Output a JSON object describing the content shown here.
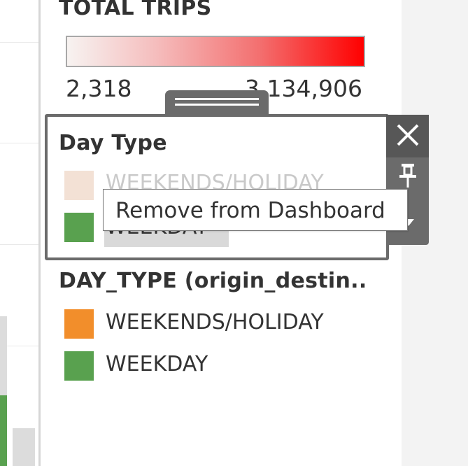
{
  "color_legend": {
    "title": "TOTAL TRIPS",
    "min_label": "2,318",
    "max_label": "3,134,906",
    "ramp_start_color": "#f7f3f1",
    "ramp_end_color": "#ff0000"
  },
  "day_type_legend": {
    "title": "Day Type",
    "items": [
      {
        "label": "WEEKENDS/HOLIDAY",
        "color": "#f3e1d5",
        "faded": true
      },
      {
        "label": "WEEKDAY",
        "color": "#59a14f",
        "highlighted": true
      }
    ],
    "toolbar": {
      "close_icon": "close-icon",
      "pin_icon": "pin-icon",
      "more_icon": "chevron-down-icon"
    }
  },
  "tooltip": {
    "text": "Remove from Dashboard"
  },
  "od_legend": {
    "title": "DAY_TYPE (origin_destin..",
    "items": [
      {
        "label": "WEEKENDS/HOLIDAY",
        "color": "#f28e2b"
      },
      {
        "label": "WEEKDAY",
        "color": "#59a14f"
      }
    ]
  },
  "colors": {
    "frame": "#6b6b6b",
    "orange": "#f28e2b",
    "green": "#59a14f"
  }
}
